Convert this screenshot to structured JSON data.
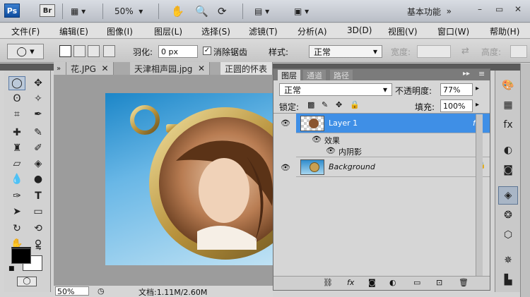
{
  "titlebar": {
    "ps_logo": "Ps",
    "br_logo": "Br",
    "zoom": "50%",
    "workspace": "基本功能",
    "minimize": "–",
    "restore": "▭",
    "close": "✕"
  },
  "menu": {
    "items": [
      "文件(F)",
      "编辑(E)",
      "图像(I)",
      "图层(L)",
      "选择(S)",
      "滤镜(T)",
      "分析(A)",
      "3D(D)",
      "视图(V)",
      "窗口(W)",
      "帮助(H)"
    ]
  },
  "options": {
    "feather_label": "羽化:",
    "feather_value": "0 px",
    "antialias_label": "消除锯齿",
    "style_label": "样式:",
    "style_value": "正常",
    "width_label": "宽度:",
    "height_label": "高度:"
  },
  "doc_tabs": [
    "花.JPG",
    "天津相声园.jpg",
    "正圆的怀表"
  ],
  "status": {
    "zoom": "50%",
    "doc_info": "文档:1.11M/2.60M"
  },
  "layers_panel": {
    "tabs": [
      "图层",
      "通道",
      "路径"
    ],
    "blend_mode": "正常",
    "opacity_label": "不透明度:",
    "opacity_value": "77%",
    "lock_label": "锁定:",
    "fill_label": "填充:",
    "fill_value": "100%",
    "layers": [
      {
        "name": "Layer 1",
        "fx": "fx",
        "selected": true
      },
      {
        "name": "Background",
        "selected": false
      }
    ],
    "effects_label": "效果",
    "inner_shadow_label": "内阴影"
  },
  "colors": {
    "selection": "#3f8fe6",
    "foreground": "#000000",
    "background": "#ffffff"
  }
}
